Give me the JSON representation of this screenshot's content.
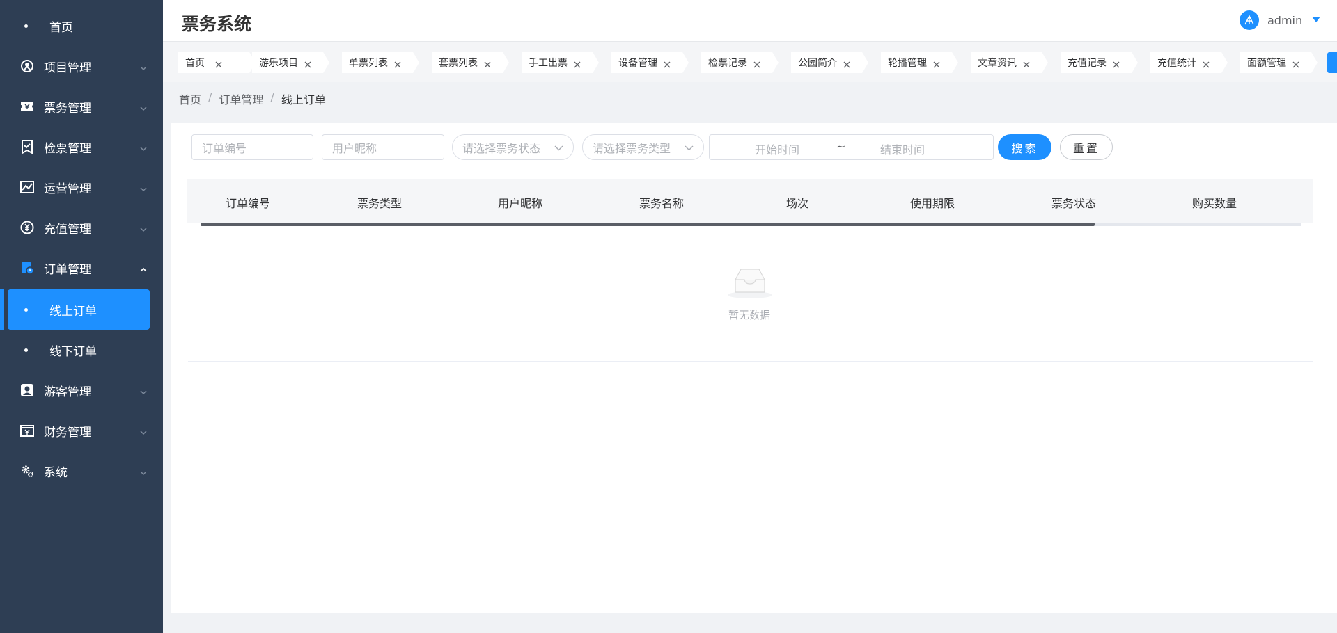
{
  "app": {
    "title": "票务系统",
    "user": "admin"
  },
  "sidebar": {
    "items": [
      {
        "label": "首页",
        "icon": "dot"
      },
      {
        "label": "项目管理",
        "icon": "project-icon"
      },
      {
        "label": "票务管理",
        "icon": "ticket-icon"
      },
      {
        "label": "检票管理",
        "icon": "check-ticket-icon"
      },
      {
        "label": "运营管理",
        "icon": "chart-icon"
      },
      {
        "label": "充值管理",
        "icon": "recharge-icon"
      },
      {
        "label": "订单管理",
        "icon": "order-icon",
        "expanded": true
      },
      {
        "label": "线上订单",
        "icon": "dot",
        "active": true
      },
      {
        "label": "线下订单",
        "icon": "dot"
      },
      {
        "label": "游客管理",
        "icon": "visitor-icon"
      },
      {
        "label": "财务管理",
        "icon": "finance-icon"
      },
      {
        "label": "系统",
        "icon": "gear-icon"
      }
    ]
  },
  "tags": [
    "首页",
    "游乐项目",
    "单票列表",
    "套票列表",
    "手工出票",
    "设备管理",
    "检票记录",
    "公园简介",
    "轮播管理",
    "文章资讯",
    "充值记录",
    "充值统计",
    "面额管理"
  ],
  "breadcrumb": [
    "首页",
    "订单管理",
    "线上订单"
  ],
  "filters": {
    "order_no_placeholder": "订单编号",
    "nickname_placeholder": "用户昵称",
    "status_placeholder": "请选择票务状态",
    "type_placeholder": "请选择票务类型",
    "start_placeholder": "开始时间",
    "range_sep": "~",
    "end_placeholder": "结束时间",
    "search_label": "搜索",
    "reset_label": "重置"
  },
  "table": {
    "columns": [
      "订单编号",
      "票务类型",
      "用户昵称",
      "票务名称",
      "场次",
      "使用期限",
      "票务状态",
      "购买数量"
    ],
    "rows": [],
    "empty_text": "暂无数据"
  },
  "colors": {
    "sidebar_bg": "#2e3e54",
    "accent": "#1e90ff",
    "page_bg": "#f0f2f5"
  }
}
